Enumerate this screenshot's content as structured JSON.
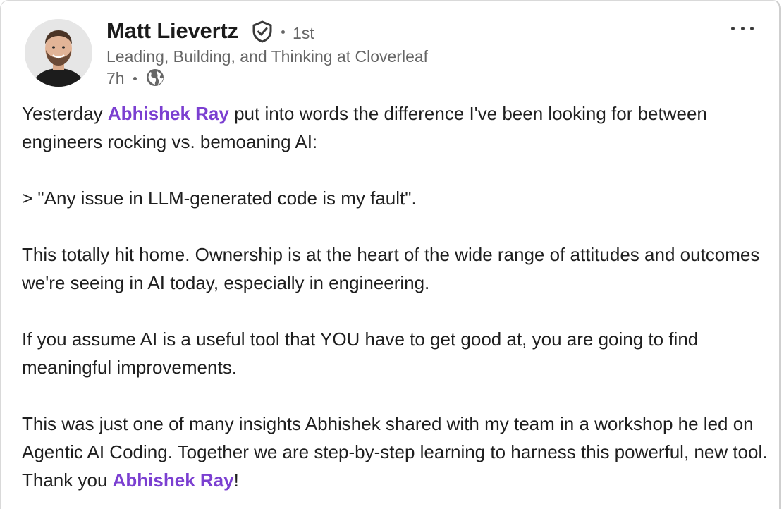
{
  "author": {
    "name": "Matt Lievertz",
    "degree": "1st",
    "headline": "Leading, Building, and Thinking at Cloverleaf",
    "time": "7h",
    "verified_icon": "verified-shield-icon",
    "visibility_icon": "globe-icon",
    "avatar_icon": "avatar"
  },
  "menu": {
    "icon": "more-options-icon"
  },
  "post": {
    "p1": {
      "before": "Yesterday ",
      "mention1": "Abhishek Ray",
      "after": " put into words the difference I've been looking for between engineers rocking vs. bemoaning AI:"
    },
    "p2": "> \"Any issue in LLM-generated code is my fault\".",
    "p3": "This totally hit home. Ownership is at the heart of the wide range of attitudes and outcomes we're seeing in AI today, especially in engineering.",
    "p4": "If you assume AI is a useful tool that YOU have to get good at, you are going to find meaningful improvements.",
    "p5": {
      "before": "This was just one of many insights Abhishek shared with my team in a workshop he led on Agentic AI Coding. Together we are step-by-step learning to harness this powerful, new tool. Thank you ",
      "mention2": "Abhishek Ray",
      "after": "!"
    }
  },
  "colors": {
    "mention": "#7b3fd1",
    "secondary_text": "#666666",
    "primary_text": "#1f1f1f"
  }
}
